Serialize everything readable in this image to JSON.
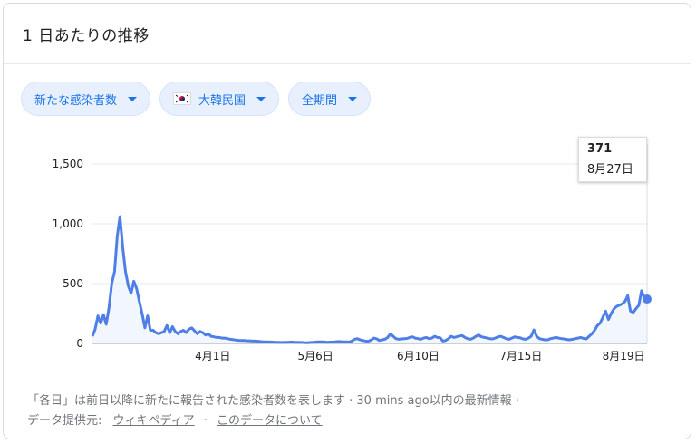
{
  "header": {
    "title": "1 日あたりの推移"
  },
  "filters": {
    "metric": "新たな感染者数",
    "region": "大韓民国",
    "period": "全期間"
  },
  "tooltip": {
    "value": "371",
    "date": "8月27日"
  },
  "footer": {
    "note": "「各日」は前日以降に新たに報告された感染者数を表します · 30 mins ago以内の最新情報 ·",
    "source_label": "データ提供元:",
    "source_link": "ウィキペディア",
    "separator": "·",
    "about_link": "このデータについて"
  },
  "colors": {
    "line": "#4f7fe6",
    "fill": "#e8f0fe",
    "chip_text": "#1a73e8",
    "grid": "#e8eaed"
  },
  "chart_data": {
    "type": "line",
    "x_start": "2020-02-20",
    "x_end": "2020-08-27",
    "x_ticks": [
      "4月1日",
      "5月6日",
      "6月10日",
      "7月15日",
      "8月19日"
    ],
    "y_ticks": [
      "0",
      "500",
      "1,000",
      "1,500"
    ],
    "ylim": [
      0,
      1500
    ],
    "series": [
      {
        "values": [
          60,
          120,
          230,
          170,
          240,
          160,
          300,
          500,
          600,
          900,
          1060,
          800,
          600,
          480,
          420,
          520,
          460,
          350,
          250,
          130,
          230,
          110,
          110,
          90,
          80,
          90,
          100,
          150,
          90,
          140,
          100,
          80,
          100,
          110,
          90,
          120,
          130,
          105,
          80,
          100,
          90,
          70,
          80,
          60,
          55,
          50,
          50,
          45,
          45,
          40,
          35,
          32,
          28,
          26,
          25,
          24,
          23,
          22,
          20,
          20,
          18,
          15,
          14,
          13,
          12,
          12,
          10,
          10,
          8,
          8,
          9,
          10,
          12,
          10,
          9,
          8,
          8,
          7,
          6,
          8,
          10,
          12,
          14,
          13,
          12,
          10,
          11,
          12,
          14,
          16,
          15,
          14,
          13,
          12,
          20,
          35,
          40,
          30,
          25,
          20,
          18,
          28,
          45,
          39,
          25,
          30,
          35,
          50,
          80,
          60,
          40,
          35,
          38,
          40,
          42,
          50,
          55,
          45,
          40,
          35,
          45,
          50,
          40,
          45,
          60,
          50,
          48,
          20,
          25,
          40,
          60,
          50,
          55,
          62,
          65,
          50,
          40,
          35,
          45,
          60,
          70,
          55,
          50,
          45,
          40,
          38,
          45,
          55,
          60,
          50,
          40,
          35,
          45,
          55,
          50,
          48,
          38,
          35,
          45,
          60,
          113,
          60,
          40,
          35,
          30,
          30,
          40,
          45,
          50,
          45,
          40,
          38,
          33,
          30,
          35,
          40,
          45,
          50,
          42,
          38,
          60,
          80,
          110,
          150,
          170,
          220,
          270,
          200,
          250,
          290,
          310,
          320,
          330,
          350,
          400,
          270,
          260,
          290,
          320,
          440,
          380,
          371
        ],
        "highlight": {
          "value": 371,
          "date": "8月27日"
        }
      }
    ]
  }
}
